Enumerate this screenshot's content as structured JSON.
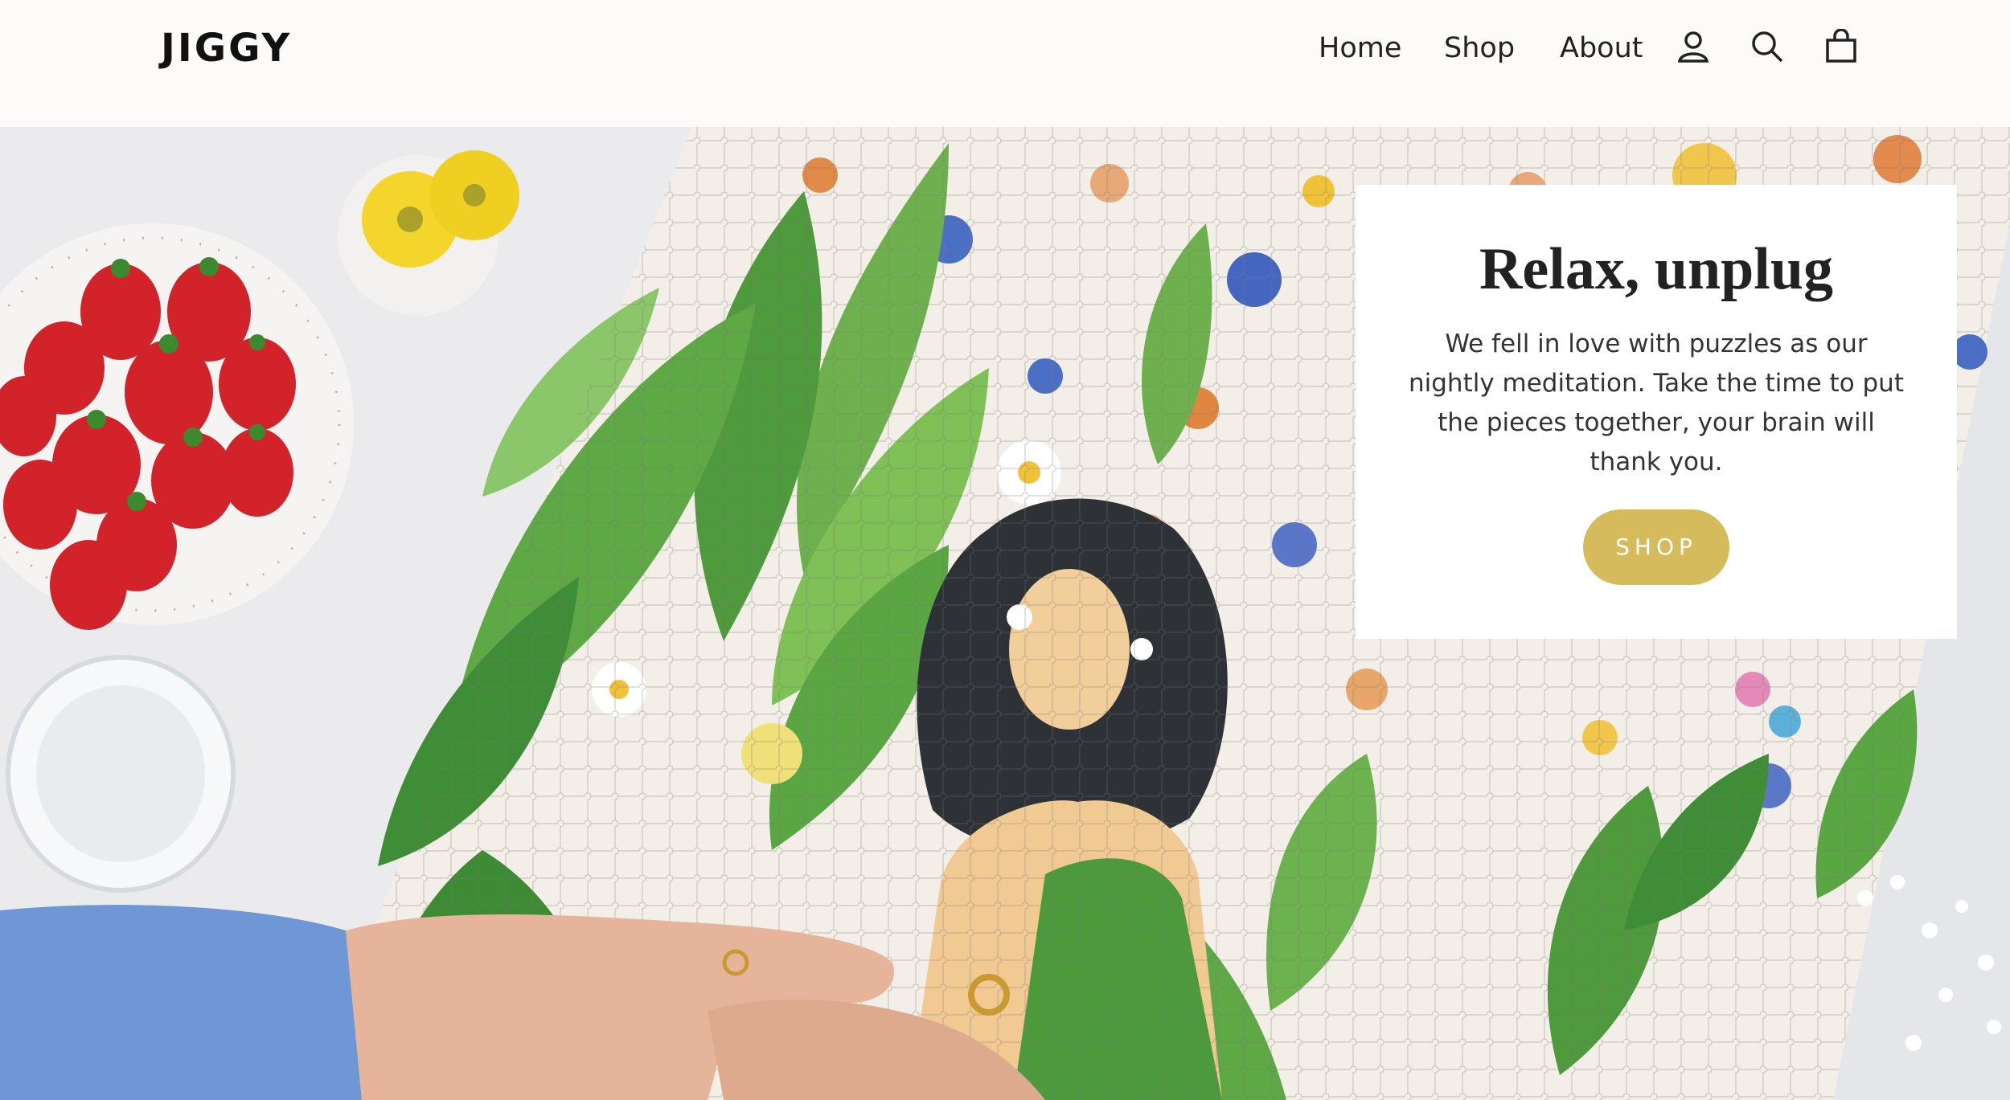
{
  "header": {
    "logo_text": "JIGGY",
    "nav": {
      "home": "Home",
      "shop": "Shop",
      "about": "About"
    },
    "icons": {
      "account": "user-icon",
      "search": "search-icon",
      "cart": "cart-icon"
    }
  },
  "hero": {
    "image": "puzzle-hero-photo",
    "card": {
      "title": "Relax, unplug",
      "body": "We fell in love with puzzles as our nightly meditation. Take the time to put the pieces together, your brain will thank you.",
      "button_label": "SHOP"
    }
  },
  "colors": {
    "header_bg": "#fcfbf9",
    "accent": "#d6bb5d",
    "card_bg": "#ffffff",
    "text_dark": "#222222"
  }
}
